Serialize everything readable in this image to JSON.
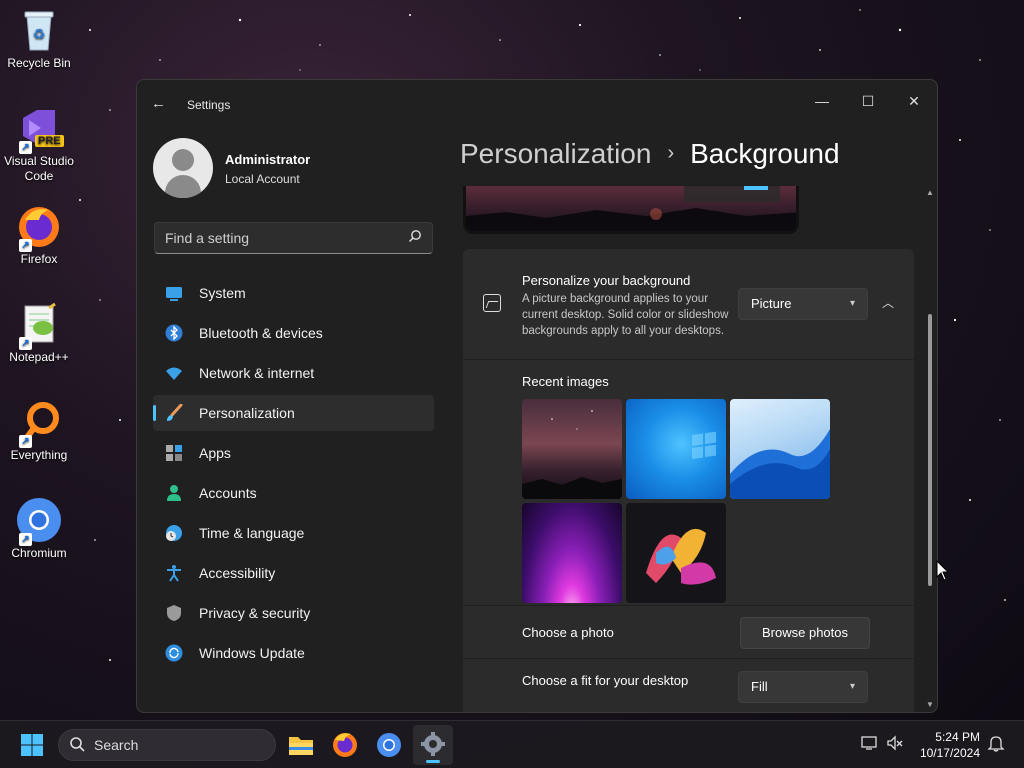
{
  "desktop": {
    "icons": [
      {
        "label": "Recycle Bin"
      },
      {
        "label": "Visual Studio Code",
        "badge": "PRE"
      },
      {
        "label": "Firefox"
      },
      {
        "label": "Notepad++"
      },
      {
        "label": "Everything"
      },
      {
        "label": "Chromium"
      }
    ]
  },
  "window": {
    "title": "Settings",
    "controls": {
      "minimize": "—",
      "maximize": "☐",
      "close": "✕"
    }
  },
  "user": {
    "name": "Administrator",
    "account_type": "Local Account"
  },
  "search": {
    "placeholder": "Find a setting"
  },
  "nav": {
    "items": [
      {
        "label": "System",
        "icon": "system-icon"
      },
      {
        "label": "Bluetooth & devices",
        "icon": "bluetooth-icon"
      },
      {
        "label": "Network & internet",
        "icon": "wifi-icon"
      },
      {
        "label": "Personalization",
        "icon": "brush-icon",
        "active": true
      },
      {
        "label": "Apps",
        "icon": "apps-icon"
      },
      {
        "label": "Accounts",
        "icon": "accounts-icon"
      },
      {
        "label": "Time & language",
        "icon": "globe-clock-icon"
      },
      {
        "label": "Accessibility",
        "icon": "accessibility-icon"
      },
      {
        "label": "Privacy & security",
        "icon": "shield-icon"
      },
      {
        "label": "Windows Update",
        "icon": "update-icon"
      }
    ]
  },
  "breadcrumb": {
    "parent": "Personalization",
    "separator": "›",
    "current": "Background"
  },
  "background": {
    "personalize_title": "Personalize your background",
    "personalize_desc": "A picture background applies to your current desktop. Solid color or slideshow backgrounds apply to all your desktops.",
    "type_value": "Picture",
    "recent_images_label": "Recent images",
    "recent_images": [
      "night-sky-landscape",
      "windows-blue-logo",
      "blue-wave",
      "purple-glow",
      "colorful-bloom"
    ],
    "choose_photo_label": "Choose a photo",
    "browse_button": "Browse photos",
    "fit_label": "Choose a fit for your desktop",
    "fit_value": "Fill"
  },
  "taskbar": {
    "search_label": "Search",
    "time": "5:24 PM",
    "date": "10/17/2024"
  },
  "colors": {
    "accent": "#4cc2ff",
    "window_bg": "#202020",
    "card_bg": "#2b2b2b"
  }
}
